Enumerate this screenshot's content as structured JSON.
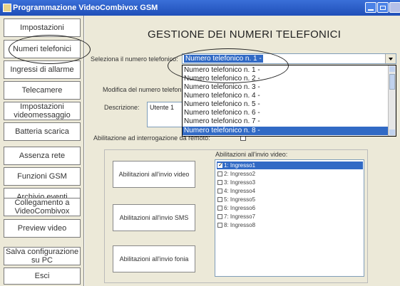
{
  "window": {
    "title": "Programmazione VideoCombivox GSM"
  },
  "sidebar": {
    "items": [
      {
        "label": "Impostazioni"
      },
      {
        "label": "Numeri telefonici"
      },
      {
        "label": "Ingressi di allarme"
      },
      {
        "label": "Telecamere"
      },
      {
        "label": "Impostazioni videomessaggio"
      },
      {
        "label": "Batteria scarica"
      },
      {
        "label": "Assenza rete"
      },
      {
        "label": "Funzioni GSM"
      },
      {
        "label": "Archivio eventi"
      },
      {
        "label": "Collegamento a VideoCombivox"
      },
      {
        "label": "Preview video"
      },
      {
        "label": "Salva configurazione su PC"
      },
      {
        "label": "Esci"
      }
    ]
  },
  "main": {
    "heading": "GESTIONE DEI NUMERI TELEFONICI",
    "select_label": "Seleziona il numero telefonico:",
    "selected_number": "Numero telefonico n. 1 -",
    "dropdown_options": [
      "Numero telefonico n. 1 -",
      "Numero telefonico n. 2 -",
      "Numero telefonico n. 3 -",
      "Numero telefonico n. 4 -",
      "Numero telefonico n. 5 -",
      "Numero telefonico n. 6 -",
      "Numero telefonico n. 7 -",
      "Numero telefonico n. 8 -"
    ],
    "dropdown_selected_index": 7,
    "modify_label": "Modifica del numero telefon",
    "description_label": "Descrizione:",
    "description_value": "Utente 1",
    "remote_label": "Abilitazione ad interrogazione da remoto:",
    "video_list_label": "Abilitazioni all'invio video:",
    "buttons": {
      "video": "Abilitazioni all'invio video",
      "sms": "Abilitazioni all'invio SMS",
      "phone": "Abilitazioni all'invio fonia"
    },
    "video_inputs": [
      {
        "label": "1: Ingresso1",
        "checked": true
      },
      {
        "label": "2: Ingresso2",
        "checked": false
      },
      {
        "label": "3: Ingresso3",
        "checked": false
      },
      {
        "label": "4: Ingresso4",
        "checked": false
      },
      {
        "label": "5: Ingresso5",
        "checked": false
      },
      {
        "label": "6: Ingresso6",
        "checked": false
      },
      {
        "label": "7: Ingresso7",
        "checked": false
      },
      {
        "label": "8: Ingresso8",
        "checked": false
      }
    ]
  },
  "colors": {
    "titlebar": "#1f4fb8",
    "selection": "#316ac5",
    "face": "#ece9d8"
  }
}
